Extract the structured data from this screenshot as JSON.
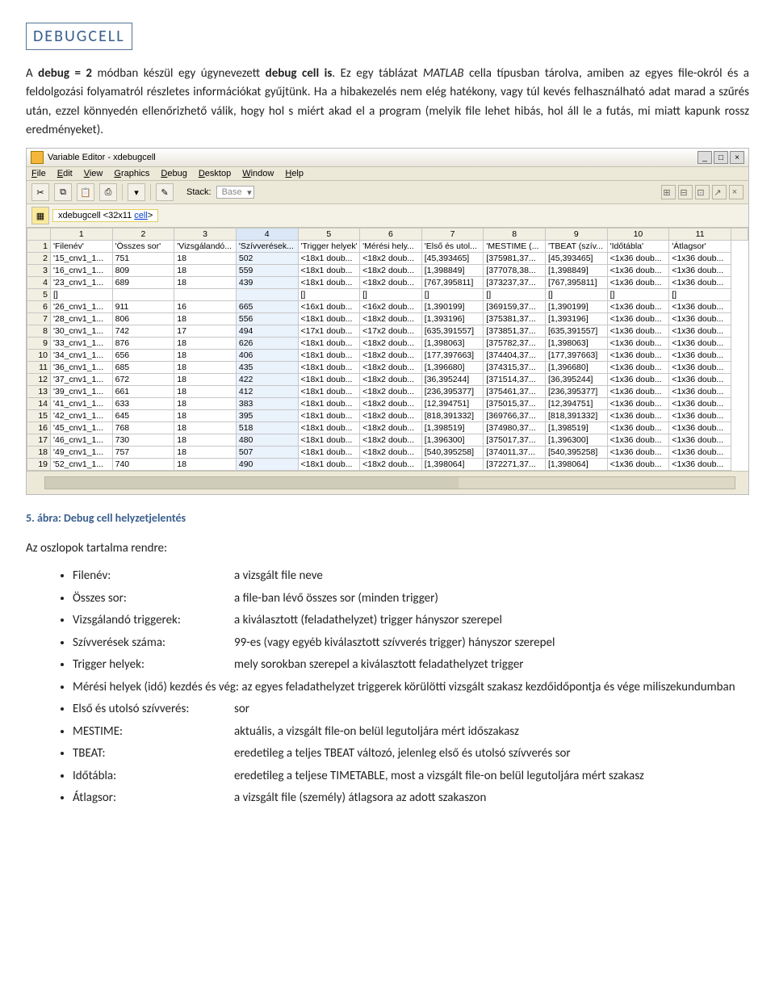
{
  "section_title": "DEBUGCELL",
  "paragraph_html": "A <b>debug = 2</b> módban készül egy úgynevezett <b>debug cell is</b>. Ez egy táblázat <i>MATLAB</i> cella típusban tárolva, amiben az egyes file-okról és a feldolgozási folyamatról részletes információkat gyűjtünk. Ha a hibakezelés nem elég hatékony, vagy túl kevés felhasználható adat marad a szűrés után, ezzel könnyedén ellenőrizhető válik, hogy hol s miért akad el a program (melyik file lehet hibás, hol áll le a futás, mi miatt kapunk rossz eredményeket).",
  "caption": "5. ábra: Debug cell helyzetjelentés",
  "subhead": "Az oszlopok tartalma rendre:",
  "defs": [
    {
      "label": "Filenév:",
      "val": "a vizsgált file neve"
    },
    {
      "label": "Összes sor:",
      "val": "a file-ban lévő összes sor (minden trigger)"
    },
    {
      "label": "Vizsgálandó triggerek:",
      "val": "a kiválasztott (feladathelyzet) trigger hányszor szerepel"
    },
    {
      "label": "Szívverések száma:",
      "val": "99-es (vagy egyéb kiválasztott szívverés trigger) hányszor szerepel"
    },
    {
      "label": "Trigger helyek:",
      "val": "mely sorokban szerepel a kiválasztott feladathelyzet trigger"
    }
  ],
  "long_defs": [
    "Mérési helyek (idő) kezdés és vég:   az egyes feladathelyzet triggerek körülötti vizsgált szakasz kezdőidőpontja és vége miliszekundumban"
  ],
  "defs2": [
    {
      "label": "Első és utolsó szívverés:",
      "val": "sor"
    },
    {
      "label": "MESTIME:",
      "val": "aktuális, a vizsgált file-on belül legutoljára mért időszakasz"
    },
    {
      "label": "TBEAT:",
      "val": "eredetileg a teljes TBEAT változó, jelenleg első és utolsó szívverés sor"
    },
    {
      "label": "Időtábla:",
      "val": "eredetileg a teljese TIMETABLE, most a vizsgált file-on belül legutoljára mért szakasz",
      "wrap": true
    },
    {
      "label": "Átlagsor:",
      "val": "a vizsgált file (személy) átlagsora az adott szakaszon"
    }
  ],
  "shot": {
    "title": "Variable Editor - xdebugcell",
    "menus": [
      "File",
      "Edit",
      "View",
      "Graphics",
      "Debug",
      "Desktop",
      "Window",
      "Help"
    ],
    "stack_label": "Stack:",
    "stack_value": "Base",
    "crumb_pre": "xdebugcell <32x11 ",
    "crumb_link": "cell",
    "crumb_post": ">",
    "col_headers": [
      "1",
      "2",
      "3",
      "4",
      "5",
      "6",
      "7",
      "8",
      "9",
      "10",
      "11"
    ],
    "rows": [
      {
        "n": "1",
        "c": [
          "'Filenév'",
          "'Összes sor'",
          "'Vizsgálandó...",
          "'Szívverések...",
          "'Trigger helyek'",
          "'Mérési hely...",
          "'Első és utol...",
          "'MESTIME (...",
          "'TBEAT (szív...",
          "'Időtábla'",
          "'Átlagsor'"
        ]
      },
      {
        "n": "2",
        "c": [
          "'15_cnv1_1...",
          "751",
          "18",
          "502",
          "<18x1 doub...",
          "<18x2 doub...",
          "[45,393465]",
          "[375981,37...",
          "[45,393465]",
          "<1x36 doub...",
          "<1x36 doub..."
        ]
      },
      {
        "n": "3",
        "c": [
          "'16_cnv1_1...",
          "809",
          "18",
          "559",
          "<18x1 doub...",
          "<18x2 doub...",
          "[1,398849]",
          "[377078,38...",
          "[1,398849]",
          "<1x36 doub...",
          "<1x36 doub..."
        ]
      },
      {
        "n": "4",
        "c": [
          "'23_cnv1_1...",
          "689",
          "18",
          "439",
          "<18x1 doub...",
          "<18x2 doub...",
          "[767,395811]",
          "[373237,37...",
          "[767,395811]",
          "<1x36 doub...",
          "<1x36 doub..."
        ]
      },
      {
        "n": "5",
        "c": [
          "[]",
          "",
          "",
          "",
          "[]",
          "[]",
          "[]",
          "[]",
          "[]",
          "[]",
          "[]"
        ]
      },
      {
        "n": "6",
        "c": [
          "'26_cnv1_1...",
          "911",
          "16",
          "665",
          "<16x1 doub...",
          "<16x2 doub...",
          "[1,390199]",
          "[369159,37...",
          "[1,390199]",
          "<1x36 doub...",
          "<1x36 doub..."
        ]
      },
      {
        "n": "7",
        "c": [
          "'28_cnv1_1...",
          "806",
          "18",
          "556",
          "<18x1 doub...",
          "<18x2 doub...",
          "[1,393196]",
          "[375381,37...",
          "[1,393196]",
          "<1x36 doub...",
          "<1x36 doub..."
        ]
      },
      {
        "n": "8",
        "c": [
          "'30_cnv1_1...",
          "742",
          "17",
          "494",
          "<17x1 doub...",
          "<17x2 doub...",
          "[635,391557]",
          "[373851,37...",
          "[635,391557]",
          "<1x36 doub...",
          "<1x36 doub..."
        ]
      },
      {
        "n": "9",
        "c": [
          "'33_cnv1_1...",
          "876",
          "18",
          "626",
          "<18x1 doub...",
          "<18x2 doub...",
          "[1,398063]",
          "[375782,37...",
          "[1,398063]",
          "<1x36 doub...",
          "<1x36 doub..."
        ]
      },
      {
        "n": "10",
        "c": [
          "'34_cnv1_1...",
          "656",
          "18",
          "406",
          "<18x1 doub...",
          "<18x2 doub...",
          "[177,397663]",
          "[374404,37...",
          "[177,397663]",
          "<1x36 doub...",
          "<1x36 doub..."
        ]
      },
      {
        "n": "11",
        "c": [
          "'36_cnv1_1...",
          "685",
          "18",
          "435",
          "<18x1 doub...",
          "<18x2 doub...",
          "[1,396680]",
          "[374315,37...",
          "[1,396680]",
          "<1x36 doub...",
          "<1x36 doub..."
        ]
      },
      {
        "n": "12",
        "c": [
          "'37_cnv1_1...",
          "672",
          "18",
          "422",
          "<18x1 doub...",
          "<18x2 doub...",
          "[36,395244]",
          "[371514,37...",
          "[36,395244]",
          "<1x36 doub...",
          "<1x36 doub..."
        ]
      },
      {
        "n": "13",
        "c": [
          "'39_cnv1_1...",
          "661",
          "18",
          "412",
          "<18x1 doub...",
          "<18x2 doub...",
          "[236,395377]",
          "[375461,37...",
          "[236,395377]",
          "<1x36 doub...",
          "<1x36 doub..."
        ]
      },
      {
        "n": "14",
        "c": [
          "'41_cnv1_1...",
          "633",
          "18",
          "383",
          "<18x1 doub...",
          "<18x2 doub...",
          "[12,394751]",
          "[375015,37...",
          "[12,394751]",
          "<1x36 doub...",
          "<1x36 doub..."
        ]
      },
      {
        "n": "15",
        "c": [
          "'42_cnv1_1...",
          "645",
          "18",
          "395",
          "<18x1 doub...",
          "<18x2 doub...",
          "[818,391332]",
          "[369766,37...",
          "[818,391332]",
          "<1x36 doub...",
          "<1x36 doub..."
        ]
      },
      {
        "n": "16",
        "c": [
          "'45_cnv1_1...",
          "768",
          "18",
          "518",
          "<18x1 doub...",
          "<18x2 doub...",
          "[1,398519]",
          "[374980,37...",
          "[1,398519]",
          "<1x36 doub...",
          "<1x36 doub..."
        ]
      },
      {
        "n": "17",
        "c": [
          "'46_cnv1_1...",
          "730",
          "18",
          "480",
          "<18x1 doub...",
          "<18x2 doub...",
          "[1,396300]",
          "[375017,37...",
          "[1,396300]",
          "<1x36 doub...",
          "<1x36 doub..."
        ]
      },
      {
        "n": "18",
        "c": [
          "'49_cnv1_1...",
          "757",
          "18",
          "507",
          "<18x1 doub...",
          "<18x2 doub...",
          "[540,395258]",
          "[374011,37...",
          "[540,395258]",
          "<1x36 doub...",
          "<1x36 doub..."
        ]
      },
      {
        "n": "19",
        "c": [
          "'52_cnv1_1...",
          "740",
          "18",
          "490",
          "<18x1 doub...",
          "<18x2 doub...",
          "[1,398064]",
          "[372271,37...",
          "[1,398064]",
          "<1x36 doub...",
          "<1x36 doub..."
        ]
      }
    ],
    "selected_col": 4
  }
}
